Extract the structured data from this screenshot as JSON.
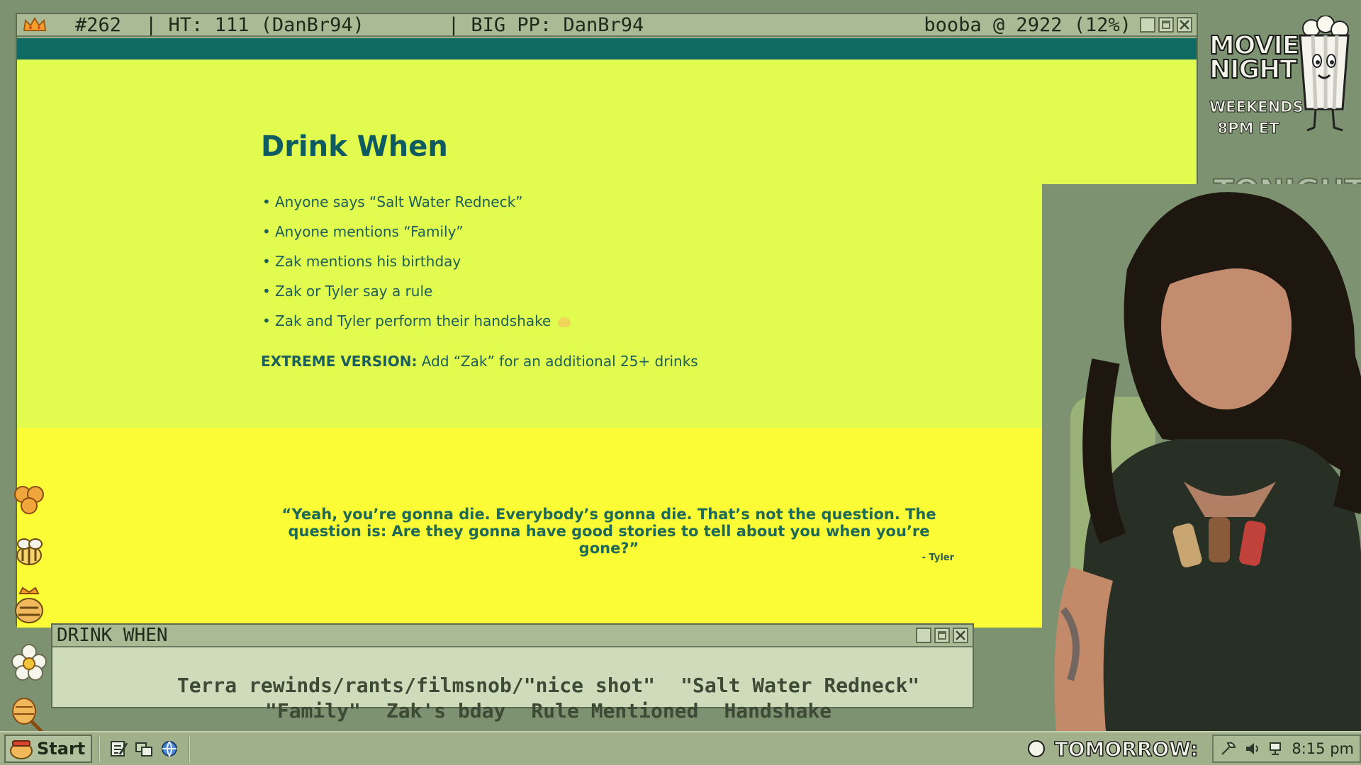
{
  "main_window": {
    "titlebar": {
      "number": "#262",
      "ht": "| HT: 111 (DanBr94)",
      "big_pp": "| BIG PP: DanBr94",
      "booba": "booba @ 2922 (12%)"
    }
  },
  "slide": {
    "title": "Drink When",
    "rules": [
      "Anyone says “Salt Water Redneck”",
      "Anyone mentions “Family”",
      "Zak mentions his birthday",
      "Zak or Tyler say a rule",
      "Zak and Tyler perform their handshake"
    ],
    "extreme_label": "EXTREME VERSION:",
    "extreme_text": " Add “Zak” for an additional 25+ drinks",
    "quote": "“Yeah, you’re gonna die. Everybody’s gonna die. That’s not the question. The question is: Are they gonna have good stories to tell about you when you’re gone?”",
    "quote_author": "- Tyler"
  },
  "drink_window": {
    "title": "DRINK WHEN",
    "row1": [
      "Terra rewinds/rants/filmsnob/\"nice shot\"",
      "\"Salt Water Redneck\""
    ],
    "row2": [
      "\"Family\"",
      "Zak's bday",
      "Rule Mentioned",
      "Handshake"
    ]
  },
  "overlay": {
    "movie_night_line1": "MOVIE",
    "movie_night_line2": "NIGHT",
    "schedule_line1": "WEEKENDS",
    "schedule_line2": "8PM ET",
    "tonight": "TONIGHT:"
  },
  "taskbar": {
    "start_label": "Start",
    "tomorrow_label": "TOMORROW:",
    "clock": "8:15 pm"
  },
  "colors": {
    "slide_upper_bg": "#e1fc4f",
    "slide_lower_bg": "#fbfc35",
    "title_teal": "#0f5c60",
    "window_frame": "#a9ba95",
    "teal_bar": "#0e6a63"
  }
}
